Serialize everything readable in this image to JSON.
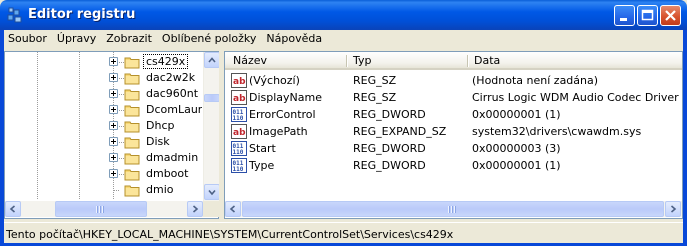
{
  "window": {
    "title": "Editor registru",
    "colors": {
      "titlebar": "#0058E6",
      "frame": "#0848D8",
      "close_button": "#D8542F"
    }
  },
  "menu": [
    "Soubor",
    "Úpravy",
    "Zobrazit",
    "Oblíbené položky",
    "Nápověda"
  ],
  "tree": {
    "items": [
      {
        "label": "cs429x",
        "selected": true,
        "expandable": true
      },
      {
        "label": "dac2w2k",
        "expandable": true
      },
      {
        "label": "dac960nt",
        "expandable": true
      },
      {
        "label": "DcomLaunch",
        "expandable": true
      },
      {
        "label": "Dhcp",
        "expandable": true
      },
      {
        "label": "Disk",
        "expandable": true
      },
      {
        "label": "dmadmin",
        "expandable": true
      },
      {
        "label": "dmboot",
        "expandable": true
      },
      {
        "label": "dmio",
        "expandable": false
      }
    ]
  },
  "list": {
    "columns": [
      "Název",
      "Typ",
      "Data"
    ],
    "rows": [
      {
        "icon": "string-value-icon",
        "name": "(Výchozí)",
        "type": "REG_SZ",
        "data": "(Hodnota není zadána)"
      },
      {
        "icon": "string-value-icon",
        "name": "DisplayName",
        "type": "REG_SZ",
        "data": "Cirrus Logic WDM Audio Codec Driver"
      },
      {
        "icon": "binary-value-icon",
        "name": "ErrorControl",
        "type": "REG_DWORD",
        "data": "0x00000001 (1)"
      },
      {
        "icon": "string-value-icon",
        "name": "ImagePath",
        "type": "REG_EXPAND_SZ",
        "data": "system32\\drivers\\cwawdm.sys"
      },
      {
        "icon": "binary-value-icon",
        "name": "Start",
        "type": "REG_DWORD",
        "data": "0x00000003 (3)"
      },
      {
        "icon": "binary-value-icon",
        "name": "Type",
        "type": "REG_DWORD",
        "data": "0x00000001 (1)"
      }
    ]
  },
  "status": {
    "path": "Tento počítač\\HKEY_LOCAL_MACHINE\\SYSTEM\\CurrentControlSet\\Services\\cs429x"
  }
}
